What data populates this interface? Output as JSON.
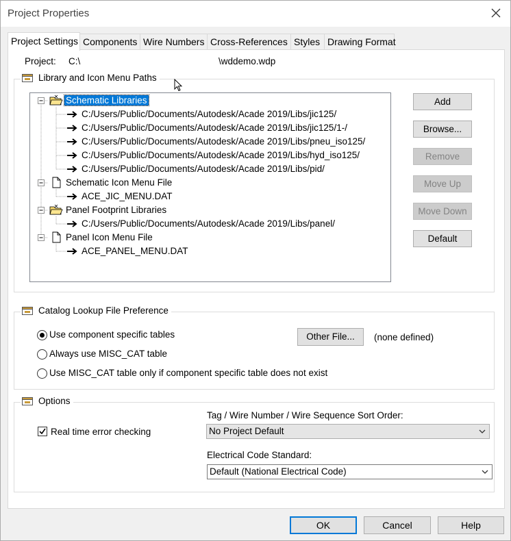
{
  "window": {
    "title": "Project Properties"
  },
  "tabs": [
    "Project Settings",
    "Components",
    "Wire Numbers",
    "Cross-References",
    "Styles",
    "Drawing Format"
  ],
  "project": {
    "label": "Project:",
    "path_start": "C:\\",
    "path_end": "\\wddemo.wdp"
  },
  "library_group": {
    "title": "Library and Icon Menu Paths",
    "tree": {
      "schematic_libraries": "Schematic Libraries",
      "schematic_paths": [
        "C:/Users/Public/Documents/Autodesk/Acade 2019/Libs/jic125/",
        "C:/Users/Public/Documents/Autodesk/Acade 2019/Libs/jic125/1-/",
        "C:/Users/Public/Documents/Autodesk/Acade 2019/Libs/pneu_iso125/",
        "C:/Users/Public/Documents/Autodesk/Acade 2019/Libs/hyd_iso125/",
        "C:/Users/Public/Documents/Autodesk/Acade 2019/Libs/pid/"
      ],
      "schematic_icon_menu": "Schematic Icon Menu File",
      "schematic_icon_file": "ACE_JIC_MENU.DAT",
      "panel_footprint": "Panel Footprint Libraries",
      "panel_paths": [
        "C:/Users/Public/Documents/Autodesk/Acade 2019/Libs/panel/"
      ],
      "panel_icon_menu": "Panel Icon Menu File",
      "panel_icon_file": "ACE_PANEL_MENU.DAT"
    },
    "buttons": {
      "add": "Add",
      "browse": "Browse...",
      "remove": "Remove",
      "move_up": "Move Up",
      "move_down": "Move Down",
      "default": "Default"
    }
  },
  "catalog_group": {
    "title": "Catalog Lookup File Preference",
    "options": [
      "Use component specific tables",
      "Always use MISC_CAT table",
      "Use MISC_CAT table only if component specific table does not exist"
    ],
    "selected_index": 0,
    "other_file_button": "Other File...",
    "other_file_value": "(none defined)"
  },
  "options_group": {
    "title": "Options",
    "realtime_label": "Real time error checking",
    "realtime_checked": true,
    "sort_order_label": "Tag / Wire Number / Wire Sequence Sort Order:",
    "sort_order_value": "No Project Default",
    "electrical_label": "Electrical Code Standard:",
    "electrical_value": "Default (National Electrical Code)"
  },
  "footer": {
    "ok": "OK",
    "cancel": "Cancel",
    "help": "Help"
  },
  "colors": {
    "selection": "#0078d7",
    "default_button_border": "#0078d7"
  }
}
